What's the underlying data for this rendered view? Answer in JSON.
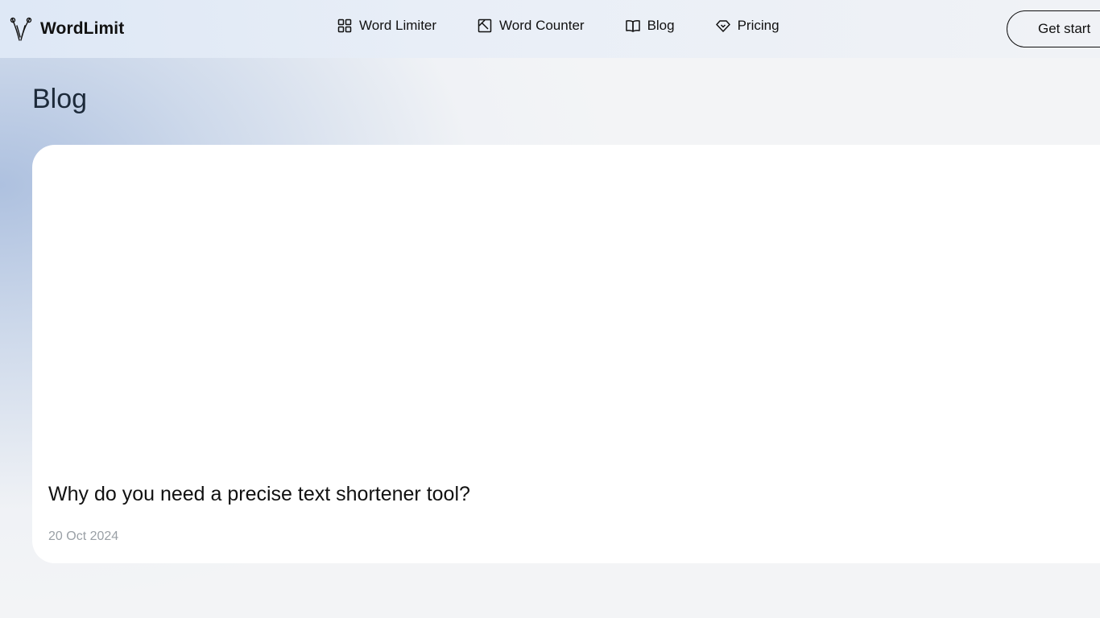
{
  "brand": {
    "name": "WordLimit",
    "logo": "scissors-logo-icon"
  },
  "nav": {
    "items": [
      {
        "label": "Word Limiter",
        "icon": "grid-icon"
      },
      {
        "label": "Word Counter",
        "icon": "edit-square-icon"
      },
      {
        "label": "Blog",
        "icon": "book-open-icon"
      },
      {
        "label": "Pricing",
        "icon": "diamond-icon"
      }
    ],
    "cta_label": "Get start"
  },
  "page": {
    "title": "Blog"
  },
  "posts": [
    {
      "title": "Why do you need a precise text shortener tool?",
      "date": "20 Oct 2024"
    }
  ],
  "colors": {
    "text": "#111111",
    "muted": "#9aa0a6",
    "background": "#f3f4f6",
    "card": "#ffffff"
  }
}
